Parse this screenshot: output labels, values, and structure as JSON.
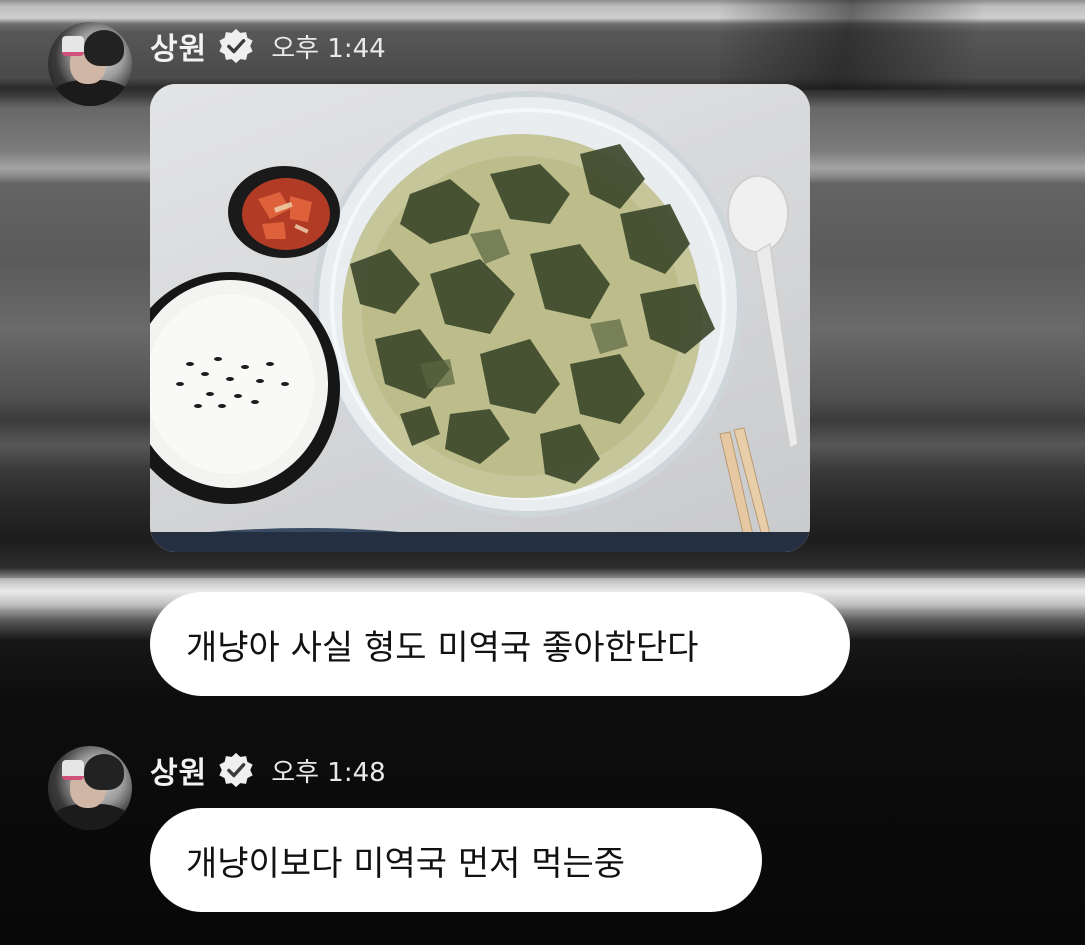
{
  "messages": [
    {
      "sender": "상원",
      "time": "오후 1:44",
      "text": "개냥아 사실 형도 미역국 좋아한단다"
    },
    {
      "sender": "상원",
      "time": "오후 1:48",
      "text": "개냥이보다 미역국 먼저 먹는중"
    }
  ],
  "icons": {
    "verified": "verified-badge-icon"
  }
}
